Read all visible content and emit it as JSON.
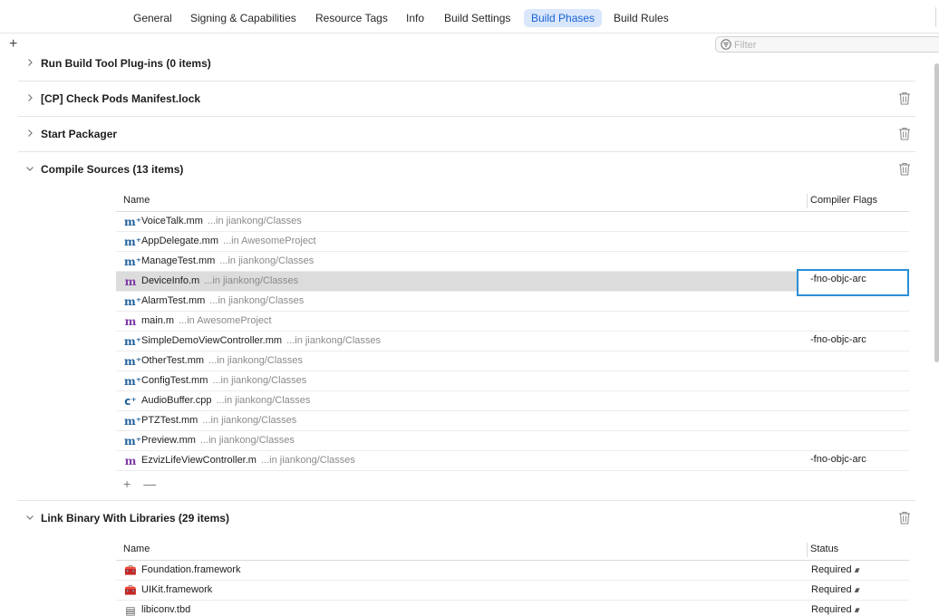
{
  "tabs": [
    {
      "label": "General",
      "active": false
    },
    {
      "label": "Signing & Capabilities",
      "active": false
    },
    {
      "label": "Resource Tags",
      "active": false
    },
    {
      "label": "Info",
      "active": false
    },
    {
      "label": "Build Settings",
      "active": false
    },
    {
      "label": "Build Phases",
      "active": true
    },
    {
      "label": "Build Rules",
      "active": false
    }
  ],
  "toolbar": {
    "add_symbol": "+",
    "filter_placeholder": "Filter"
  },
  "phases": {
    "run_build_tool": {
      "title": "Run Build Tool Plug-ins (0 items)",
      "expanded": false
    },
    "check_pods": {
      "title": "[CP] Check Pods Manifest.lock",
      "expanded": false
    },
    "start_packager": {
      "title": "Start Packager",
      "expanded": false
    },
    "compile_sources": {
      "title": "Compile Sources (13 items)",
      "expanded": true,
      "col_name": "Name",
      "col_flags": "Compiler Flags",
      "files": [
        {
          "icon": "objc-plus-plus-icon",
          "glyph": "m⁺",
          "kind": "mm",
          "name": "VoiceTalk.mm",
          "location": "...in jiankong/Classes",
          "flags": ""
        },
        {
          "icon": "objc-plus-plus-icon",
          "glyph": "m⁺",
          "kind": "mm",
          "name": "AppDelegate.mm",
          "location": "...in AwesomeProject",
          "flags": ""
        },
        {
          "icon": "objc-plus-plus-icon",
          "glyph": "m⁺",
          "kind": "mm",
          "name": "ManageTest.mm",
          "location": "...in jiankong/Classes",
          "flags": ""
        },
        {
          "icon": "objc-icon",
          "glyph": "m",
          "kind": "m",
          "name": "DeviceInfo.m",
          "location": "...in jiankong/Classes",
          "flags": "-fno-objc-arc",
          "selected": true,
          "editing": true
        },
        {
          "icon": "objc-plus-plus-icon",
          "glyph": "m⁺",
          "kind": "mm",
          "name": "AlarmTest.mm",
          "location": "...in jiankong/Classes",
          "flags": ""
        },
        {
          "icon": "objc-icon",
          "glyph": "m",
          "kind": "m",
          "name": "main.m",
          "location": "...in AwesomeProject",
          "flags": ""
        },
        {
          "icon": "objc-plus-plus-icon",
          "glyph": "m⁺",
          "kind": "mm",
          "name": "SimpleDemoViewController.mm",
          "location": "...in jiankong/Classes",
          "flags": "-fno-objc-arc"
        },
        {
          "icon": "objc-plus-plus-icon",
          "glyph": "m⁺",
          "kind": "mm",
          "name": "OtherTest.mm",
          "location": "...in jiankong/Classes",
          "flags": ""
        },
        {
          "icon": "objc-plus-plus-icon",
          "glyph": "m⁺",
          "kind": "mm",
          "name": "ConfigTest.mm",
          "location": "...in jiankong/Classes",
          "flags": ""
        },
        {
          "icon": "cpp-icon",
          "glyph": "c⁺",
          "kind": "cc",
          "name": "AudioBuffer.cpp",
          "location": "...in jiankong/Classes",
          "flags": ""
        },
        {
          "icon": "objc-plus-plus-icon",
          "glyph": "m⁺",
          "kind": "mm",
          "name": "PTZTest.mm",
          "location": "...in jiankong/Classes",
          "flags": ""
        },
        {
          "icon": "objc-plus-plus-icon",
          "glyph": "m⁺",
          "kind": "mm",
          "name": "Preview.mm",
          "location": "...in jiankong/Classes",
          "flags": ""
        },
        {
          "icon": "objc-icon",
          "glyph": "m",
          "kind": "m",
          "name": "EzvizLifeViewController.m",
          "location": "...in jiankong/Classes",
          "flags": "-fno-objc-arc"
        }
      ],
      "add_symbol": "+",
      "remove_symbol": "—"
    },
    "link_binary": {
      "title": "Link Binary With Libraries (29 items)",
      "expanded": true,
      "col_name": "Name",
      "col_status": "Status",
      "libs": [
        {
          "icon": "framework-icon",
          "glyph": "🧰",
          "kind": "fw",
          "name": "Foundation.framework",
          "status": "Required"
        },
        {
          "icon": "framework-icon",
          "glyph": "🧰",
          "kind": "fw",
          "name": "UIKit.framework",
          "status": "Required"
        },
        {
          "icon": "tbd-file-icon",
          "glyph": "▤",
          "kind": "tbd",
          "name": "libiconv.tbd",
          "status": "Required"
        }
      ]
    }
  }
}
